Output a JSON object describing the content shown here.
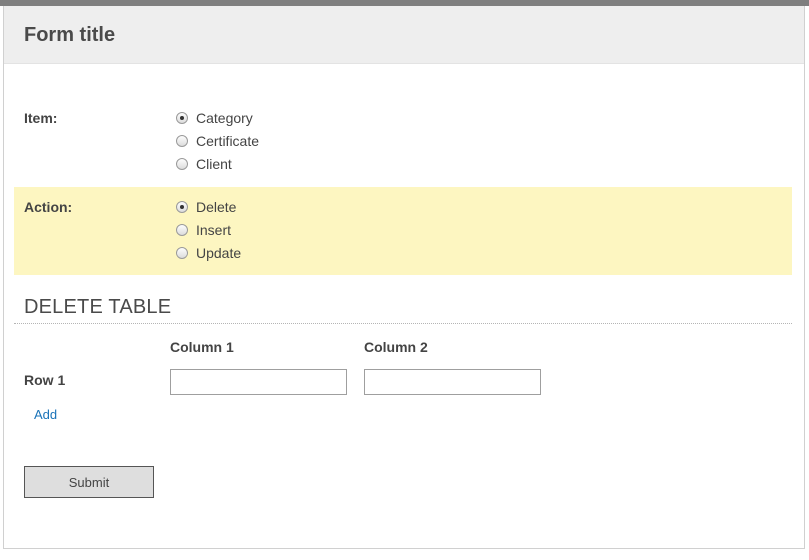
{
  "form": {
    "title": "Form title"
  },
  "item": {
    "label": "Item:",
    "options": [
      {
        "label": "Category",
        "checked": true
      },
      {
        "label": "Certificate",
        "checked": false
      },
      {
        "label": "Client",
        "checked": false
      }
    ]
  },
  "action": {
    "label": "Action:",
    "options": [
      {
        "label": "Delete",
        "checked": true
      },
      {
        "label": "Insert",
        "checked": false
      },
      {
        "label": "Update",
        "checked": false
      }
    ]
  },
  "table": {
    "title": "DELETE TABLE",
    "columns": [
      "Column 1",
      "Column 2"
    ],
    "rows": [
      {
        "label": "Row 1",
        "values": [
          "",
          ""
        ]
      }
    ],
    "add_label": "Add"
  },
  "submit_label": "Submit",
  "colors": {
    "highlight": "#fdf6c1",
    "header_bg": "#eeeeee",
    "link": "#1a73b8"
  }
}
